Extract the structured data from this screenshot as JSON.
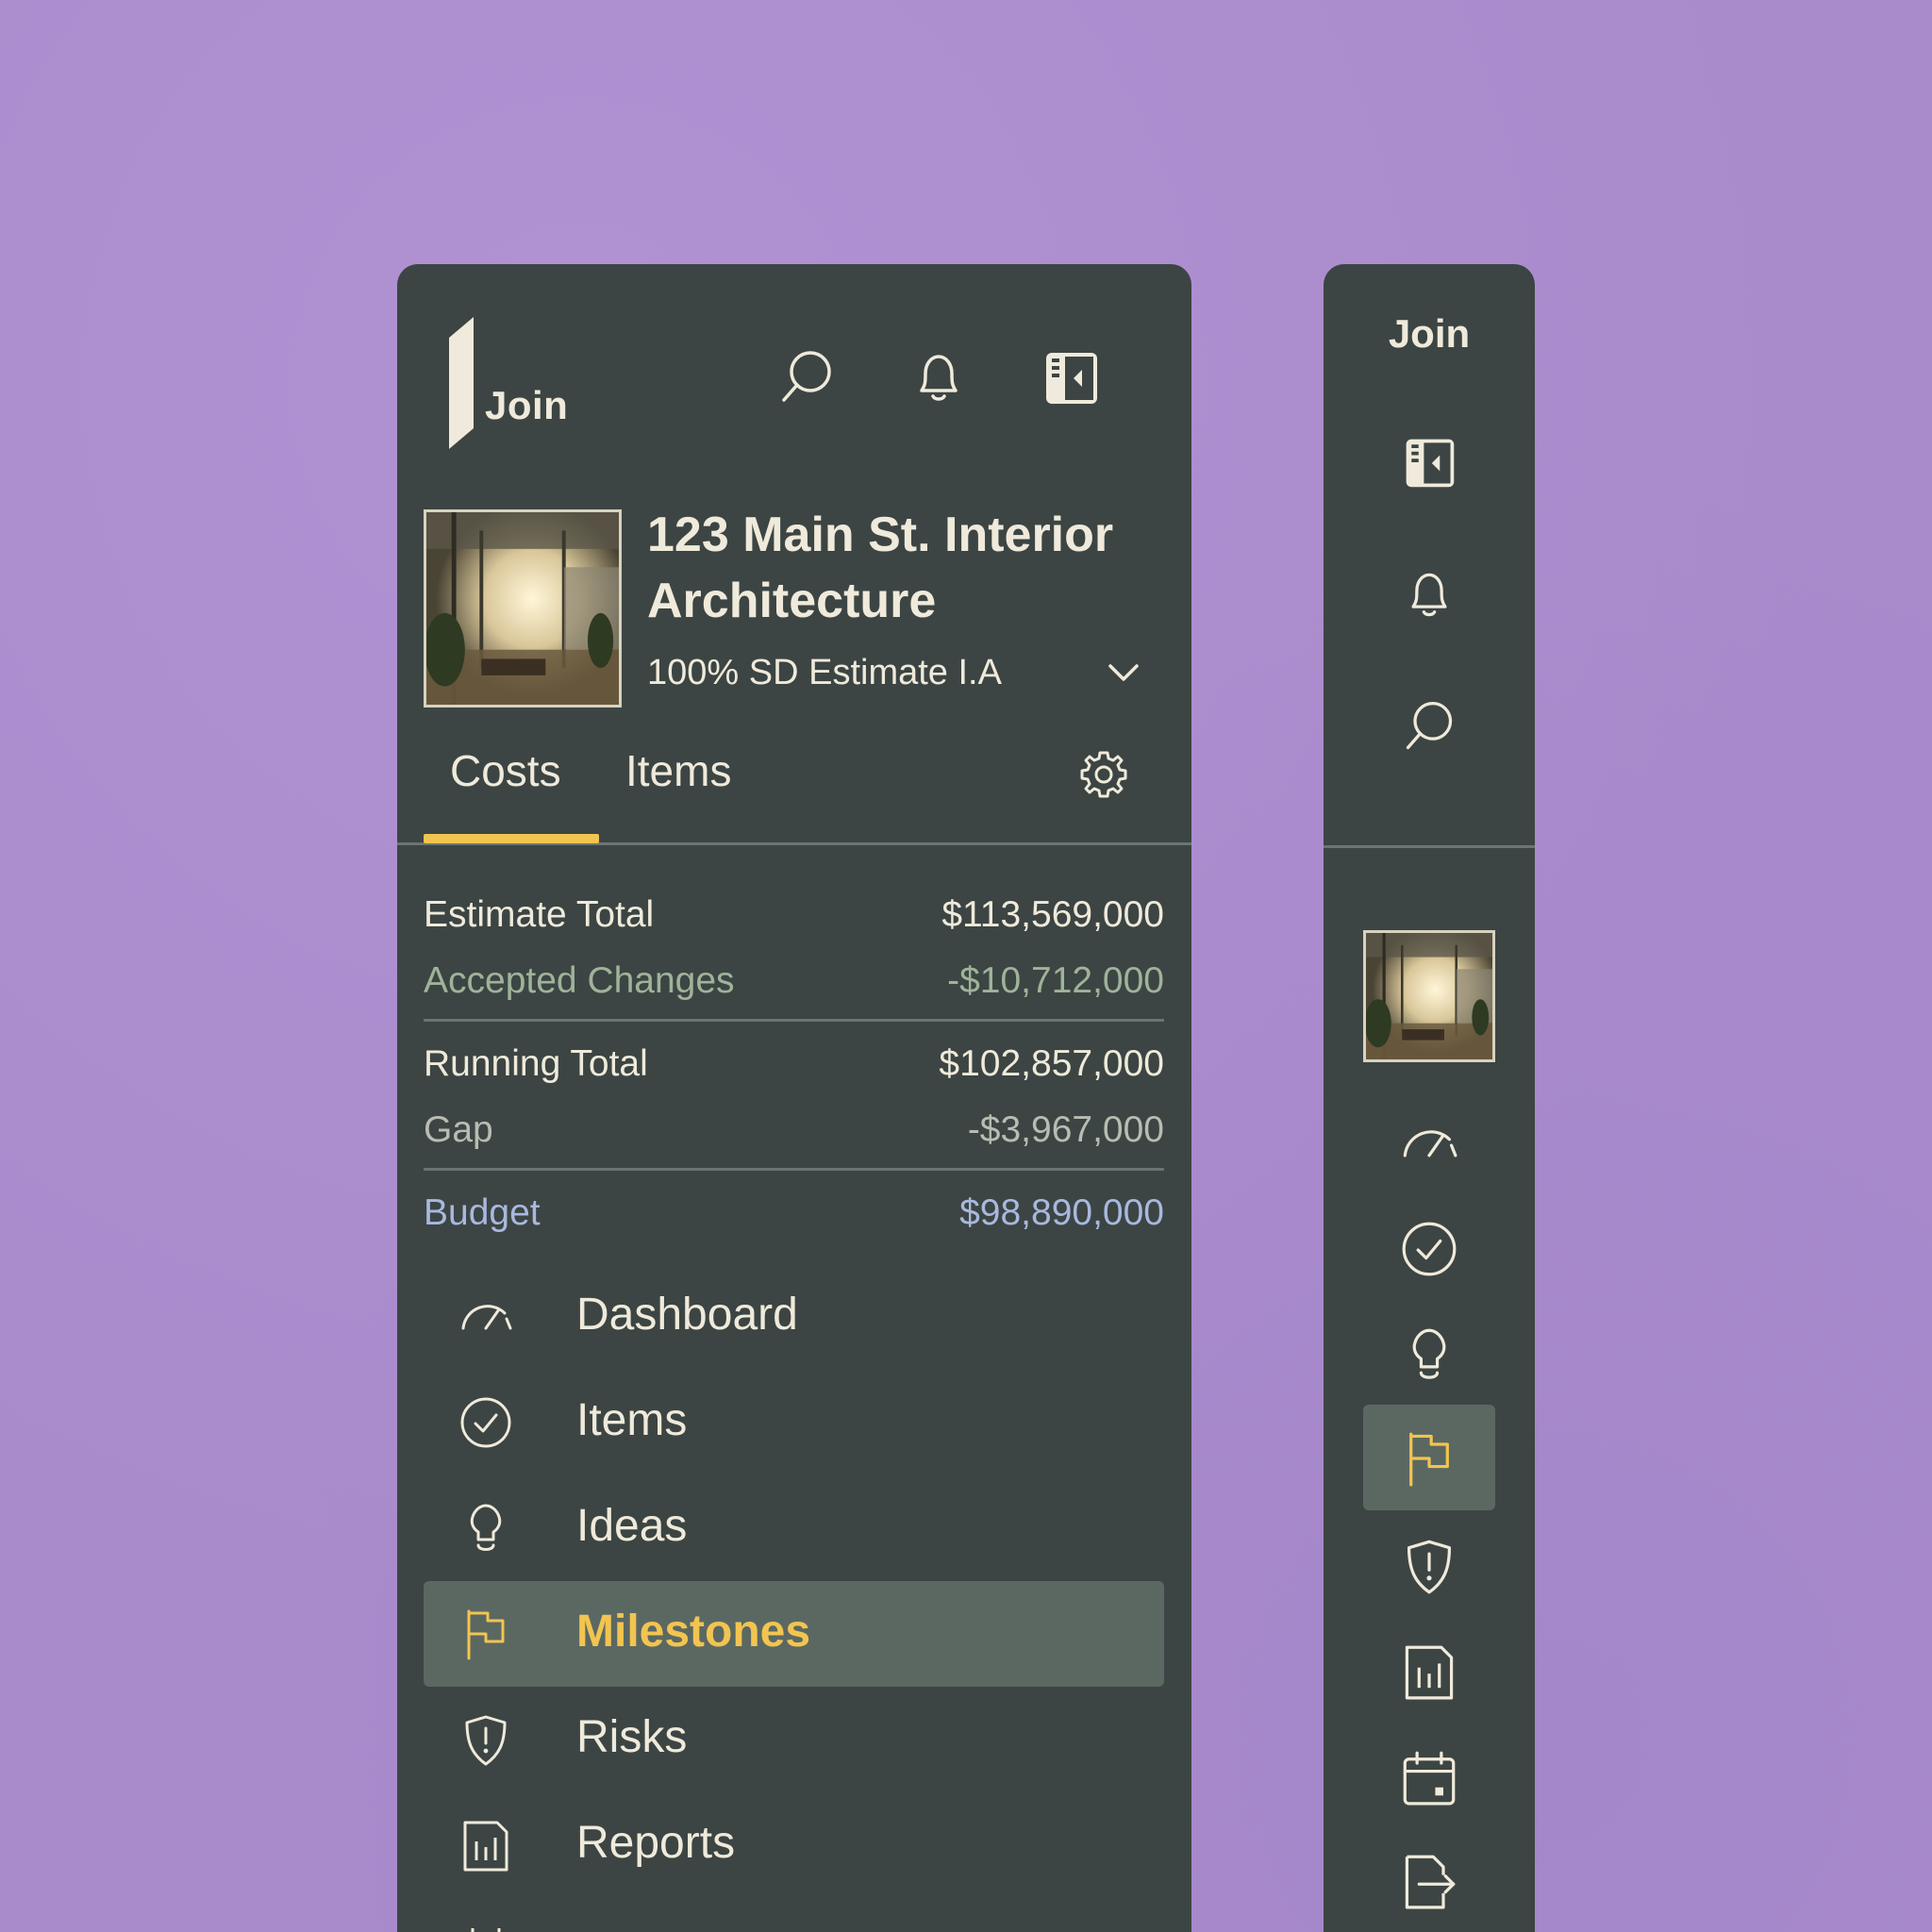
{
  "app": {
    "logo_text": "Join"
  },
  "project": {
    "title": "123 Main St. Interior Architecture",
    "estimate": "100% SD Estimate I.A"
  },
  "tabs": [
    {
      "label": "Costs",
      "active": true
    },
    {
      "label": "Items",
      "active": false
    }
  ],
  "costs": {
    "estimate_total": {
      "label": "Estimate Total",
      "value": "$113,569,000"
    },
    "accepted_changes": {
      "label": "Accepted Changes",
      "value": "-$10,712,000"
    },
    "running_total": {
      "label": "Running Total",
      "value": "$102,857,000"
    },
    "gap": {
      "label": "Gap",
      "value": "-$3,967,000"
    },
    "budget": {
      "label": "Budget",
      "value": "$98,890,000"
    }
  },
  "nav": [
    {
      "label": "Dashboard",
      "icon": "gauge-icon",
      "active": false
    },
    {
      "label": "Items",
      "icon": "check-circle-icon",
      "active": false
    },
    {
      "label": "Ideas",
      "icon": "lightbulb-icon",
      "active": false
    },
    {
      "label": "Milestones",
      "icon": "flag-icon",
      "active": true
    },
    {
      "label": "Risks",
      "icon": "shield-alert-icon",
      "active": false
    },
    {
      "label": "Reports",
      "icon": "report-icon",
      "active": false
    }
  ],
  "colors": {
    "background": "#a98bcc",
    "panel": "#3c4543",
    "accent": "#f2c450",
    "active_row": "#5b6862",
    "text": "#efeadb",
    "muted_green": "#9fb39a",
    "muted_gray": "#b8bcb2",
    "budget_blue": "#a9b8de"
  }
}
